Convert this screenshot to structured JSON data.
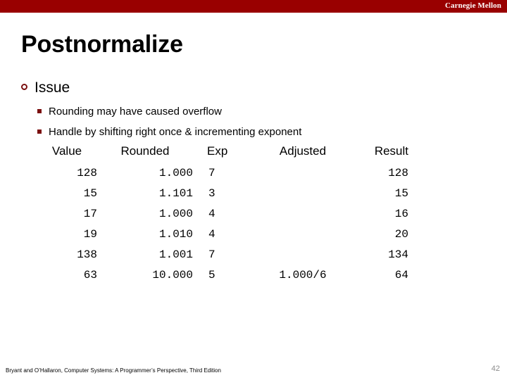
{
  "header": {
    "brand": "Carnegie Mellon",
    "bar_color": "#990000"
  },
  "slide": {
    "title": "Postnormalize",
    "accent_color": "#7b1010"
  },
  "bullets": {
    "level1": "Issue",
    "level2": [
      "Rounding may have caused overflow",
      "Handle by shifting right once & incrementing exponent"
    ]
  },
  "table": {
    "columns": [
      "Value",
      "Rounded",
      "Exp",
      "Adjusted",
      "Result"
    ],
    "rows": [
      {
        "value": "128",
        "rounded": "1.000",
        "exp": "7",
        "adjusted": "",
        "result": "128"
      },
      {
        "value": "15",
        "rounded": "1.101",
        "exp": "3",
        "adjusted": "",
        "result": "15"
      },
      {
        "value": "17",
        "rounded": "1.000",
        "exp": "4",
        "adjusted": "",
        "result": "16"
      },
      {
        "value": "19",
        "rounded": "1.010",
        "exp": "4",
        "adjusted": "",
        "result": "20"
      },
      {
        "value": "138",
        "rounded": "1.001",
        "exp": "7",
        "adjusted": "",
        "result": "134"
      },
      {
        "value": "63",
        "rounded": "10.000",
        "exp": "5",
        "adjusted": "1.000/6",
        "result": "64"
      }
    ]
  },
  "footer": {
    "citation": "Bryant and O’Hallaron, Computer Systems: A Programmer’s Perspective, Third Edition",
    "page_number": "42"
  }
}
